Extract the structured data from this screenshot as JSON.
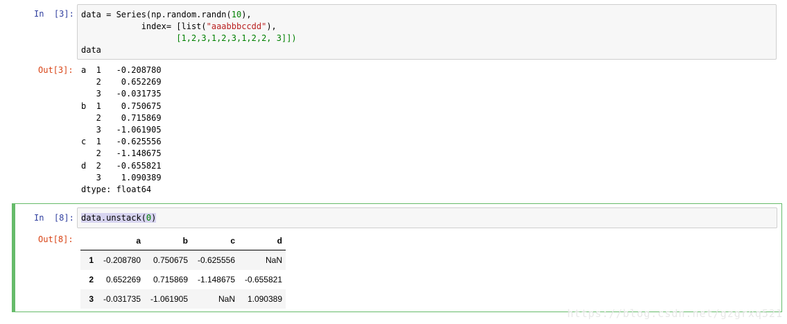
{
  "cell1": {
    "in_prompt": "In  [3]:",
    "out_prompt": "Out[3]:",
    "code": {
      "line1_a": "data = Series(np.random.randn(",
      "line1_num": "10",
      "line1_b": "),",
      "line2_a": "            index= [list(",
      "line2_str": "\"aaabbbccdd\"",
      "line2_b": "),",
      "line3": "                   [1,2,3,1,2,3,1,2,2, 3]])",
      "line4": "data"
    },
    "output": "a  1   -0.208780\n   2    0.652269\n   3   -0.031735\nb  1    0.750675\n   2    0.715869\n   3   -1.061905\nc  1   -0.625556\n   2   -1.148675\nd  2   -0.655821\n   3    1.090389\ndtype: float64"
  },
  "cell2": {
    "in_prompt": "In  [8]:",
    "out_prompt": "Out[8]:",
    "code_a": "data.unstack(",
    "code_num": "0",
    "code_b": ")",
    "table": {
      "columns": [
        "",
        "a",
        "b",
        "c",
        "d"
      ],
      "rows": [
        {
          "index": "1",
          "a": "-0.208780",
          "b": "0.750675",
          "c": "-0.625556",
          "d": "NaN"
        },
        {
          "index": "2",
          "a": "0.652269",
          "b": "0.715869",
          "c": "-1.148675",
          "d": "-0.655821"
        },
        {
          "index": "3",
          "a": "-0.031735",
          "b": "-1.061905",
          "c": "NaN",
          "d": "1.090389"
        }
      ]
    }
  },
  "watermark": "https://blog.csdn.net/gzgrxq521"
}
